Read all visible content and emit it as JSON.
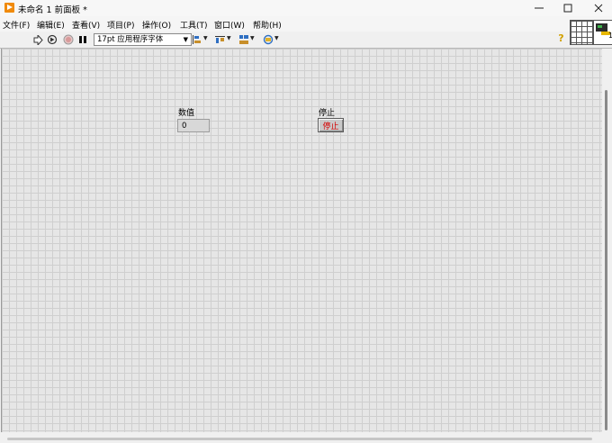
{
  "window": {
    "title": "未命名 1 前面板 *",
    "controls": [
      "minimize",
      "maximize",
      "close"
    ]
  },
  "menu": {
    "items": [
      "文件(F)",
      "编辑(E)",
      "查看(V)",
      "项目(P)",
      "操作(O)",
      "工具(T)",
      "窗口(W)",
      "帮助(H)"
    ]
  },
  "toolbar": {
    "icons": [
      "run-arrow-icon",
      "run-continuously-icon",
      "abort-icon",
      "pause-icon"
    ],
    "font_select": "17pt 应用程序字体",
    "dropdowns": [
      "align-objects-icon",
      "distribute-objects-icon",
      "resize-objects-icon",
      "reorder-icon"
    ],
    "help_icon": "?"
  },
  "vi_icon": {
    "number": "1"
  },
  "front_panel": {
    "numeric_label": "数值",
    "numeric_value": "0",
    "stop_label": "停止",
    "stop_button_text": "停止"
  }
}
